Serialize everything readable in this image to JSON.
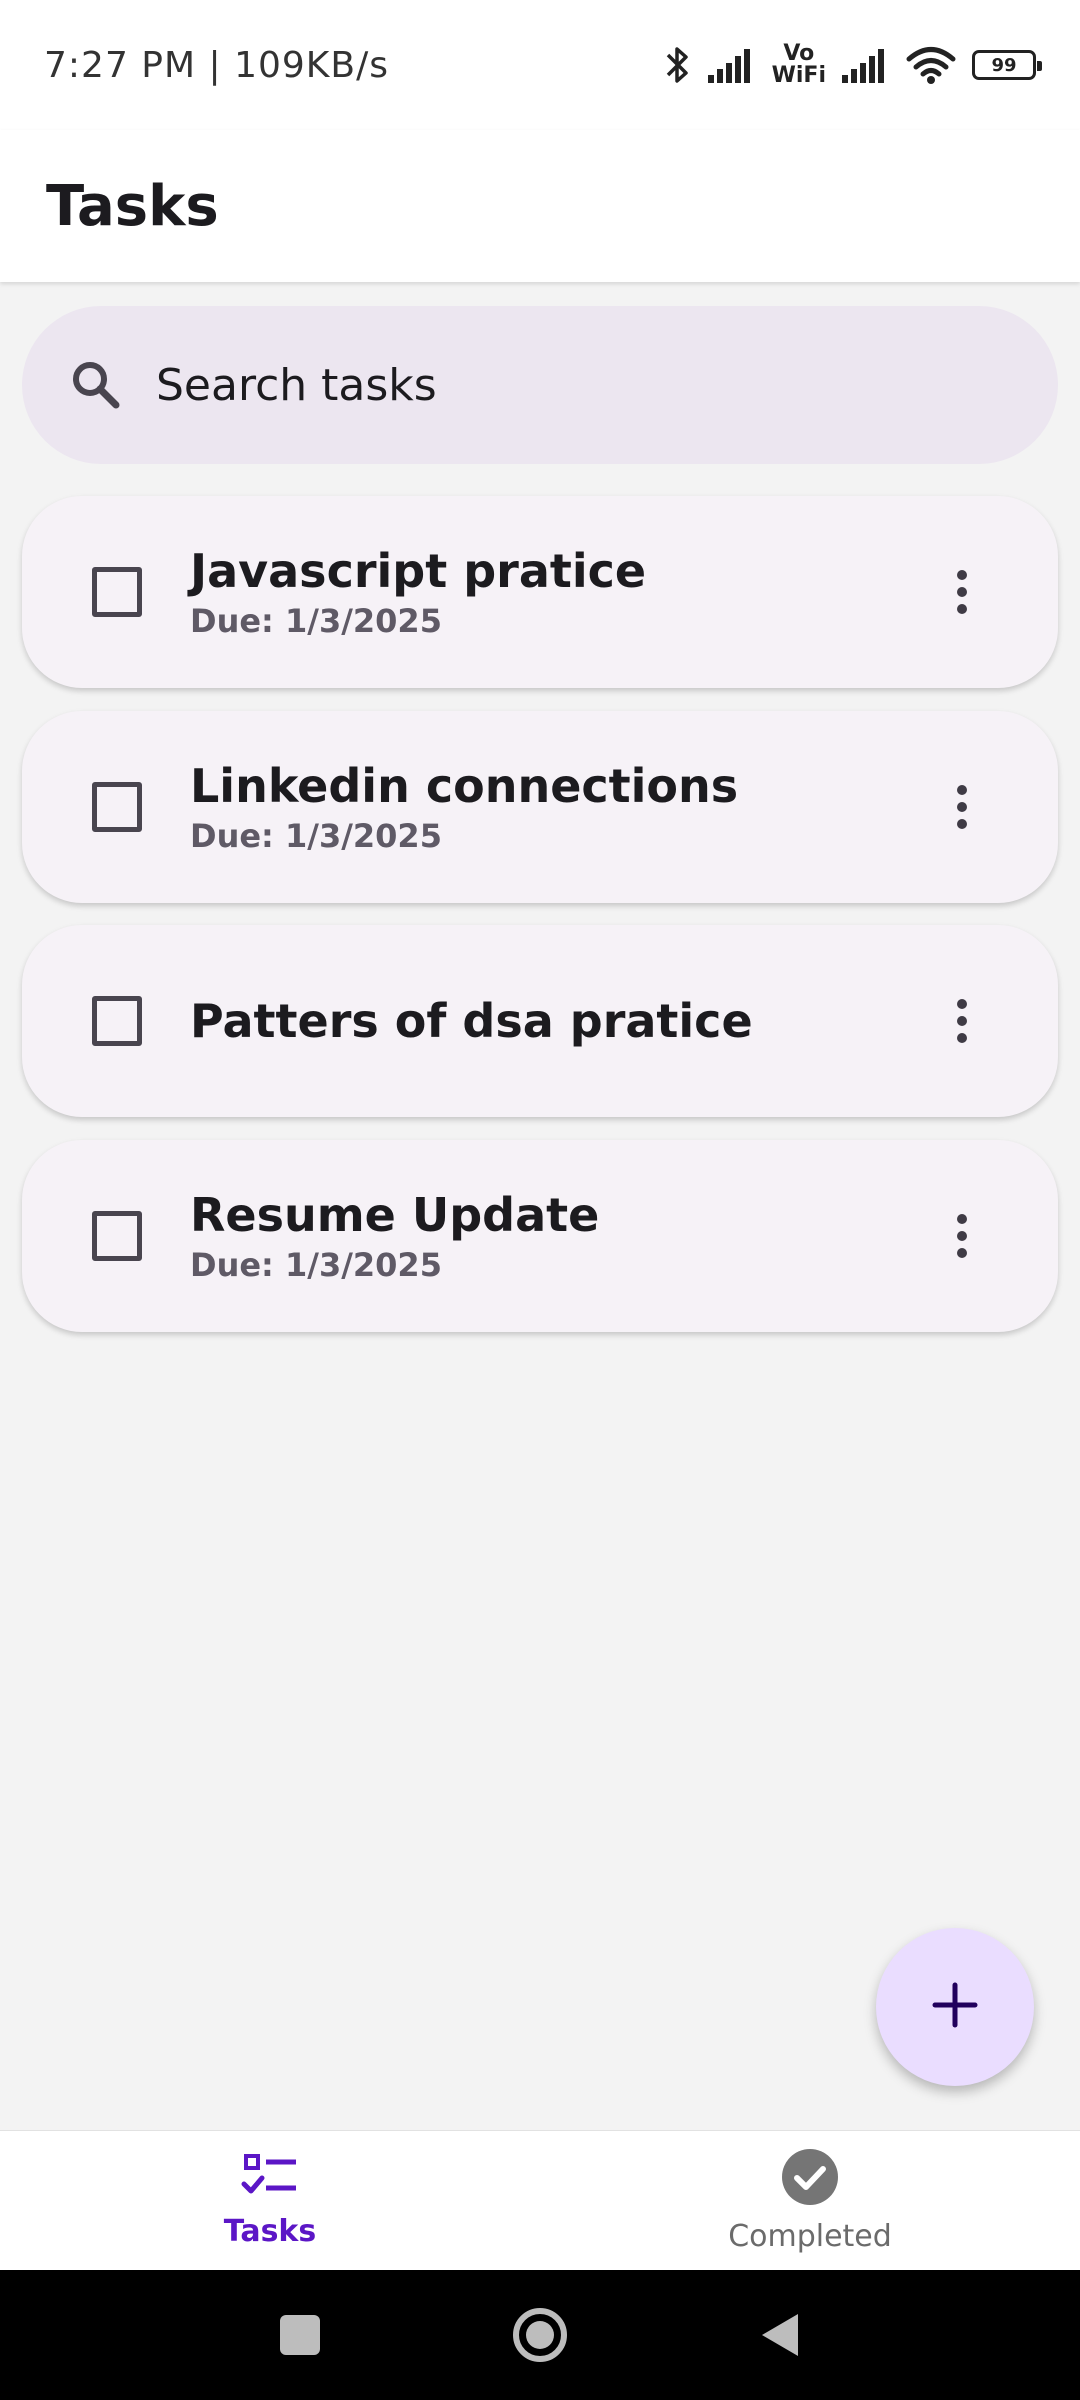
{
  "status_bar": {
    "time": "7:27 PM | 109KB/s",
    "volte_top": "Vo",
    "volte_bottom": "WiFi",
    "battery": "99"
  },
  "app_bar": {
    "title": "Tasks"
  },
  "search": {
    "placeholder": "Search tasks"
  },
  "tasks": [
    {
      "title": "Javascript pratice",
      "due": "Due: 1/3/2025",
      "completed": false
    },
    {
      "title": "Linkedin connections",
      "due": "Due: 1/3/2025",
      "completed": false
    },
    {
      "title": "Patters of dsa pratice",
      "due": "",
      "completed": false
    },
    {
      "title": "Resume Update",
      "due": "Due: 1/3/2025",
      "completed": false
    }
  ],
  "bottom_nav": {
    "items": [
      {
        "label": "Tasks",
        "icon": "task-list-icon",
        "active": true
      },
      {
        "label": "Completed",
        "icon": "check-circle-icon",
        "active": false
      }
    ]
  },
  "fab": {
    "icon": "plus-icon"
  },
  "colors": {
    "accent": "#5b16c6",
    "search_bg": "#ece6f0",
    "card_bg": "#f6f2f7",
    "fab_bg": "#eaddff"
  }
}
